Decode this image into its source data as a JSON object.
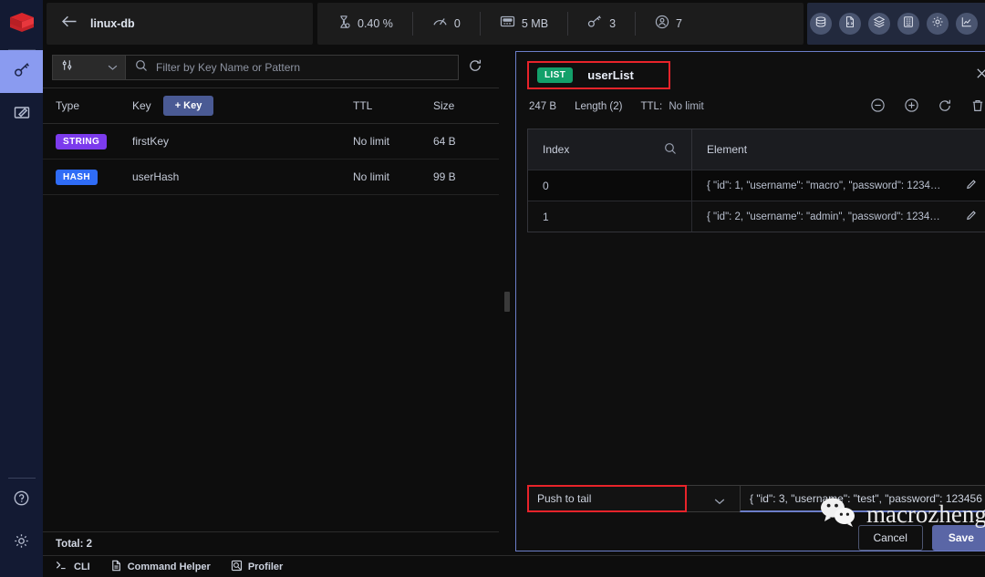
{
  "sidebar": {
    "logo_icon": "redis-logo-icon",
    "items": [
      {
        "icon": "key-icon",
        "name": "browser",
        "active": true
      },
      {
        "icon": "workbench-edit-icon",
        "name": "workbench",
        "active": false
      }
    ],
    "bottom_items": [
      {
        "icon": "help-circle-icon",
        "name": "help"
      },
      {
        "icon": "gear-icon",
        "name": "settings"
      }
    ]
  },
  "topbar": {
    "back_icon": "arrow-left-icon",
    "database_name": "linux-db",
    "stats": [
      {
        "icon": "cpu-icon",
        "value": "0.40 %",
        "name": "cpu"
      },
      {
        "icon": "speedometer-icon",
        "value": "0",
        "name": "commands-per-second"
      },
      {
        "icon": "memory-icon",
        "value": "5 MB",
        "name": "memory"
      },
      {
        "icon": "key-icon",
        "value": "3",
        "name": "total-keys"
      },
      {
        "icon": "user-icon",
        "value": "7",
        "name": "connected-clients"
      }
    ],
    "tools": [
      {
        "icon": "database-icon",
        "name": "browser-tool"
      },
      {
        "icon": "document-icon",
        "name": "workbench-tool"
      },
      {
        "icon": "layers-icon",
        "name": "analysis-tool"
      },
      {
        "icon": "slowlog-icon",
        "name": "slowlog-tool"
      },
      {
        "icon": "gear-icon",
        "name": "configuration-tool"
      },
      {
        "icon": "chart-line-icon",
        "name": "pubsub-tool"
      }
    ],
    "kebab_icon": "more-vertical-icon"
  },
  "keys_panel": {
    "filter": {
      "type_icon": "filter-sliders-icon",
      "chevron_icon": "chevron-down-icon",
      "search_icon": "search-icon",
      "placeholder": "Filter by Key Name or Pattern",
      "value": "",
      "refresh_icon": "refresh-icon"
    },
    "columns": {
      "type": "Type",
      "key": "Key",
      "ttl": "TTL",
      "size": "Size"
    },
    "add_key_label": "+ Key",
    "rows": [
      {
        "type": "STRING",
        "type_color": "#7c3bed",
        "key": "firstKey",
        "ttl": "No limit",
        "size": "64 B"
      },
      {
        "type": "HASH",
        "type_color": "#2f6cf6",
        "key": "userHash",
        "ttl": "No limit",
        "size": "99 B"
      }
    ],
    "total_label": "Total: 2"
  },
  "detail_panel": {
    "key_type": "LIST",
    "key_type_color": "#13a06a",
    "key_name": "userList",
    "close_icon": "close-icon",
    "size": "247 B",
    "length": "Length (2)",
    "ttl_label": "TTL:",
    "ttl_value": "No limit",
    "actions": [
      {
        "icon": "minus-circle-icon",
        "name": "remove-element"
      },
      {
        "icon": "plus-circle-icon",
        "name": "add-element"
      },
      {
        "icon": "refresh-icon",
        "name": "refresh-key"
      },
      {
        "icon": "trash-icon",
        "name": "delete-key"
      }
    ],
    "table": {
      "index_header": "Index",
      "index_search_icon": "search-icon",
      "element_header": "Element",
      "rows": [
        {
          "index": "0",
          "element": "{ \"id\": 1, \"username\": \"macro\", \"password\": 1234…",
          "edit_icon": "pencil-icon"
        },
        {
          "index": "1",
          "element": "{ \"id\": 2, \"username\": \"admin\", \"password\": 1234…",
          "edit_icon": "pencil-icon"
        }
      ]
    },
    "add_form": {
      "destination": "Push to tail",
      "destination_chevron_icon": "chevron-down-icon",
      "element_value": "{     \"id\": 3,    \"username\": \"test\",      \"password\": 123456",
      "cancel_label": "Cancel",
      "save_label": "Save"
    },
    "border_color": "#6c7ec9",
    "annotation_color": "#e8232a"
  },
  "watermark": {
    "icon": "wechat-icon",
    "text": "macrozheng"
  },
  "bottombar": {
    "items": [
      {
        "icon": "terminal-icon",
        "label": "CLI",
        "name": "cli"
      },
      {
        "icon": "document-icon",
        "label": "Command Helper",
        "name": "command-helper"
      },
      {
        "icon": "profiler-icon",
        "label": "Profiler",
        "name": "profiler"
      }
    ]
  }
}
